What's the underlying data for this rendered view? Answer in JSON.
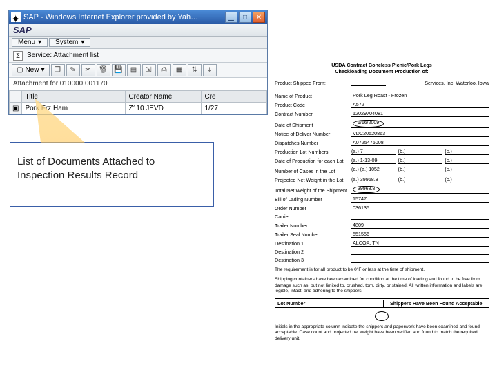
{
  "sap": {
    "title": "SAP - Windows Internet Explorer provided by Yah…",
    "brand": "SAP",
    "menu": {
      "menu_label": "Menu",
      "system_label": "System"
    },
    "service_label": "Service: Attachment list",
    "new_label": "New",
    "info_line": "Attachment for 010000 001170",
    "table": {
      "headers": {
        "icon": "",
        "title": "Title",
        "creator": "Creator Name",
        "cre": "Cre"
      },
      "row": {
        "icon": "▣",
        "title": "Pork Frz Ham",
        "creator": "Z110 JEVD",
        "cre": "1/27"
      }
    },
    "toolbar_icons": [
      "doc-new-icon",
      "doc-copy-icon",
      "pencil-icon",
      "scissors-icon",
      "trash-icon",
      "save-icon",
      "filter-icon",
      "nav-icon",
      "print-icon",
      "grid-icon",
      "sort-icon",
      "export-icon"
    ]
  },
  "callout": {
    "line1": "List of Documents Attached to",
    "line2": "Inspection Results Record"
  },
  "doc": {
    "title1": "USDA Contract Boneless Picnic/Pork Legs",
    "title2": "Checkloading Document Production of:",
    "shipped_from_lab": "Product Shipped From:",
    "shipped_right": "Services, Inc.   Waterloo, Iowa",
    "fields": {
      "name_of_product": {
        "lab": "Name of Product",
        "val": "Pork Leg Roast - Frozen"
      },
      "product_code": {
        "lab": "Product Code",
        "val": "A572"
      },
      "contract_number": {
        "lab": "Contract Number",
        "val": "12029704081"
      },
      "date_of_shipment": {
        "lab": "Date of Shipment",
        "val": "1/16/2009"
      },
      "notice_deliver": {
        "lab": "Notice of Deliver Number",
        "val": "VDC20520863"
      },
      "dispatches": {
        "lab": "Dispatches Number",
        "val": "A0725476008"
      },
      "prod_lot_numbers": {
        "lab": "Production Lot Numbers",
        "a": "(a.) 7",
        "b": "(b.)",
        "c": "(c.)"
      },
      "date_prod_each_lot": {
        "lab": "Date of Production for each Lot",
        "a": "(a.) 1-13-09",
        "b": "(b.)",
        "c": "(c.)"
      },
      "num_cases": {
        "lab": "Number of Cases in the Lot",
        "a": "(a.) 1052",
        "b": "(b.)",
        "c": "(c.)"
      },
      "proj_net_weight": {
        "lab": "Projected Net Weight in the Lot",
        "a": "(a.) 39968.8",
        "b": "(b.)",
        "c": "(c.)"
      },
      "total_net_weight": {
        "lab": "Total Net Weight of the Shipment",
        "val": "39968.8"
      },
      "bol": {
        "lab": "Bill of Lading Number",
        "val": "15747"
      },
      "order_number": {
        "lab": "Order Number",
        "val": "036135"
      },
      "carrier": {
        "lab": "Carrier",
        "val": ""
      },
      "trailer_number": {
        "lab": "Trailer Number",
        "val": "4809"
      },
      "trailer_seal": {
        "lab": "Trailer Seal Number",
        "val": "551556"
      },
      "dest1": {
        "lab": "Destination 1",
        "val": "ALCOA, TN"
      },
      "dest2": {
        "lab": "Destination 2",
        "val": ""
      },
      "dest3": {
        "lab": "Destination 3",
        "val": ""
      }
    },
    "note1": "The requirement is for all product to be 0°F or less at the time of shipment.",
    "note2": "Shipping containers have been examined for condition at the time of loading and found to be free from damage such as, but not limited to, crushed, torn, dirty, or stained.  All written information and labels are legible, intact, and adhering to the shippers.",
    "bar": {
      "left": "Lot Number",
      "right": "Shippers Have Been Found Acceptable"
    },
    "note3": "Initials in the appropriate column indicate the shippers and paperwork have been examined and found acceptable. Case count and projected net weight have been verified and found to match the required delivery unit."
  }
}
